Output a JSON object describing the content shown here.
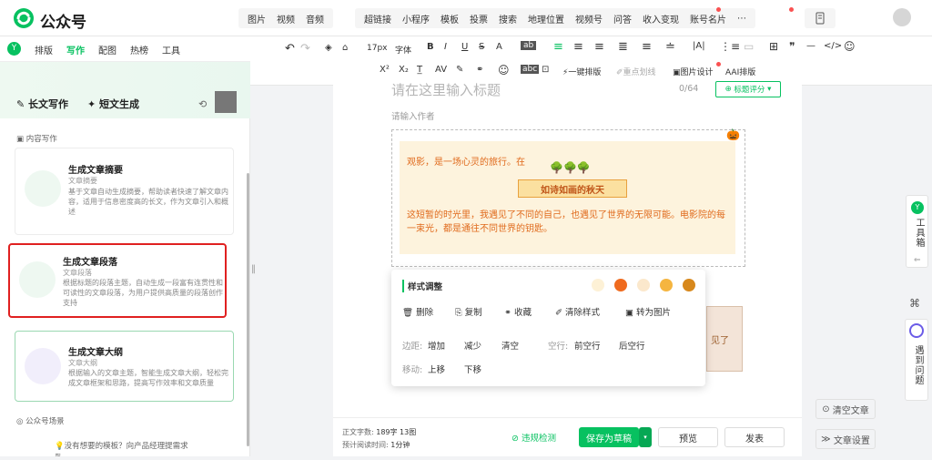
{
  "header": {
    "brand": "公众号",
    "groups": [
      [
        "图片",
        "视频",
        "音频"
      ],
      [
        "超链接",
        "小程序",
        "模板",
        "投票",
        "搜索",
        "地理位置",
        "视频号",
        "问答",
        "收入变现",
        "账号名片",
        "⋯"
      ]
    ]
  },
  "sidebar": {
    "tabs": [
      "排版",
      "写作",
      "配图",
      "热榜",
      "工具"
    ],
    "mode_long": "长文写作",
    "mode_short": "短文生成",
    "section_content": "内容写作",
    "section_mp": "公众号场景",
    "bottom_tip": "没有想要的模板？向产品经理提需求",
    "cards": [
      {
        "title": "生成文章摘要",
        "sub": "文章摘要",
        "desc": "基于文章自动生成摘要，帮助读者快速了解文章内容，适用于信息密度高的长文，作为文章引入和概述"
      },
      {
        "title": "生成文章段落",
        "sub": "文章段落",
        "desc": "根据标题的段落主题，自动生成一段富有连贯性和可读性的文章段落，为用户提供高质量的段落创作支持"
      },
      {
        "title": "生成文章大纲",
        "sub": "文章大纲",
        "desc": "根据输入的文章主题，智能生成文章大纲，轻松完成文章框架和思路，提高写作效率和文章质量"
      }
    ]
  },
  "format": {
    "font_size": "17px",
    "font": "字体",
    "one_key": "一键排版",
    "highlight": "重点划线",
    "image_design": "图片设计",
    "ai": "AI排版"
  },
  "editor": {
    "title_placeholder": "请在这里输入标题",
    "title_count": "0/64",
    "score": "标题评分",
    "author_placeholder": "请输入作者",
    "line1": "观影，是一场心灵的旅行。在",
    "banner": "如诗如画的秋天",
    "para": "这短暂的时光里，我遇见了不同的自己，也遇见了世界的无限可能。电影院的每一束光，都是通往不同世界的钥匙。",
    "hidden": "见了"
  },
  "popup": {
    "title": "样式调整",
    "actions": [
      "删除",
      "复制",
      "收藏",
      "清除样式",
      "转为图片"
    ],
    "margin_label": "边距:",
    "margin_ops": [
      "增加",
      "减少",
      "清空"
    ],
    "line_label": "空行:",
    "line_ops": [
      "前空行",
      "后空行"
    ],
    "move_label": "移动:",
    "move_ops": [
      "上移",
      "下移"
    ],
    "swatches": [
      "#fdf1d6",
      "#ef6b1f",
      "#fbe8cc",
      "#f5b540",
      "#d7881c"
    ]
  },
  "footer": {
    "word_label": "正文字数:",
    "word_val": "189字 13图",
    "time_label": "预计阅读时间:",
    "time_val": "1分钟",
    "check": "违规检测",
    "save": "保存为草稿",
    "preview": "预览",
    "publish": "发表",
    "clear": "清空文章",
    "settings": "文章设置"
  },
  "toolbox": {
    "label": "工具箱",
    "help": "遇到问题"
  },
  "colors": {
    "brand": "#07c160",
    "highlight_border": "#e02020"
  }
}
